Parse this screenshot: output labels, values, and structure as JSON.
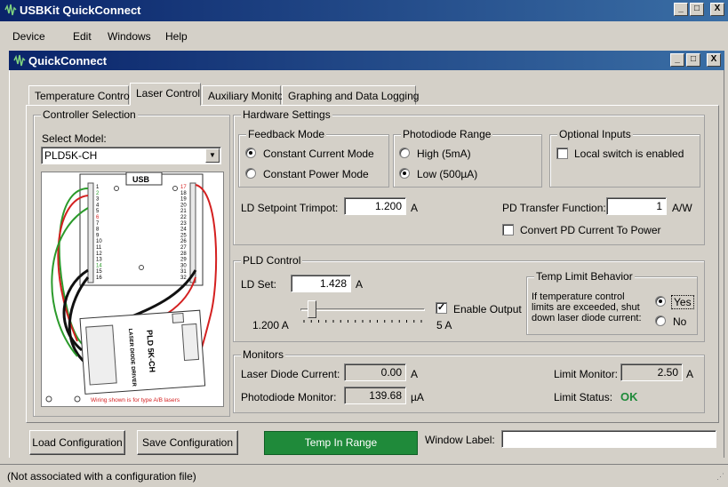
{
  "app": {
    "title": "USBKit QuickConnect",
    "inner_title": "QuickConnect",
    "window_buttons": {
      "minimize": "_",
      "restore": "□",
      "close": "X"
    }
  },
  "menu": {
    "items": [
      "Device",
      "Edit",
      "Windows",
      "Help"
    ]
  },
  "tabs": [
    {
      "label": "Temperature Control",
      "active": false
    },
    {
      "label": "Laser Control",
      "active": true
    },
    {
      "label": "Auxiliary Monitor",
      "active": false
    },
    {
      "label": "Graphing and Data Logging",
      "active": false
    }
  ],
  "controller": {
    "legend": "Controller Selection",
    "select_label": "Select Model:",
    "model": "PLD5K-CH",
    "diagram": {
      "usb_label": "USB",
      "pins_left": [
        "1",
        "2",
        "3",
        "4",
        "5",
        "6",
        "7",
        "8",
        "9",
        "10",
        "11",
        "12",
        "13",
        "14",
        "15",
        "16"
      ],
      "pins_right": [
        "17",
        "18",
        "19",
        "20",
        "21",
        "22",
        "23",
        "24",
        "25",
        "26",
        "27",
        "28",
        "29",
        "30",
        "31",
        "32"
      ],
      "board_title": "LASER DIODE DRIVER",
      "board_model": "PLD 5K-CH",
      "wiring_note": "Wiring shown is for type A/B lasers"
    }
  },
  "hardware": {
    "legend": "Hardware Settings",
    "feedback": {
      "legend": "Feedback Mode",
      "options": [
        {
          "label": "Constant Current Mode",
          "selected": true
        },
        {
          "label": "Constant Power Mode",
          "selected": false
        }
      ]
    },
    "photodiode": {
      "legend": "Photodiode Range",
      "options": [
        {
          "label": "High (5mA)",
          "selected": false
        },
        {
          "label": "Low (500µA)",
          "selected": true
        }
      ]
    },
    "optional": {
      "legend": "Optional Inputs",
      "local_switch_label": "Local switch is enabled",
      "local_switch_checked": false
    },
    "ld_trimpot_label": "LD Setpoint Trimpot:",
    "ld_trimpot_value": "1.200",
    "ld_trimpot_unit": "A",
    "pd_transfer_label": "PD Transfer Function:",
    "pd_transfer_value": "1",
    "pd_transfer_unit": "A/W",
    "convert_label": "Convert PD Current To Power",
    "convert_checked": false
  },
  "pld": {
    "legend": "PLD Control",
    "ld_set_label": "LD Set:",
    "ld_set_value": "1.428",
    "ld_set_unit": "A",
    "slider_min_label": "1.200 A",
    "slider_max_label": "5 A",
    "slider_fraction": 0.06,
    "enable_output_label": "Enable Output",
    "enable_output_checked": true,
    "temp_limit": {
      "legend": "Temp Limit Behavior",
      "text": "If temperature control limits are exceeded, shut down laser diode current:",
      "options": [
        {
          "label": "Yes",
          "selected": true
        },
        {
          "label": "No",
          "selected": false
        }
      ]
    }
  },
  "monitors": {
    "legend": "Monitors",
    "laser_current_label": "Laser Diode Current:",
    "laser_current_value": "0.00",
    "laser_current_unit": "A",
    "photodiode_label": "Photodiode Monitor:",
    "photodiode_value": "139.68",
    "photodiode_unit": "µA",
    "limit_monitor_label": "Limit Monitor:",
    "limit_monitor_value": "2.50",
    "limit_monitor_unit": "A",
    "limit_status_label": "Limit Status:",
    "limit_status_value": "OK",
    "limit_status_color": "#1f8a3a"
  },
  "footer": {
    "load_button": "Load Configuration",
    "save_button": "Save Configuration",
    "status_button": "Temp In Range",
    "status_color": "#1f8a3a",
    "window_label": "Window Label:",
    "window_label_value": ""
  },
  "statusbar": {
    "text": "(Not associated with a configuration file)"
  }
}
